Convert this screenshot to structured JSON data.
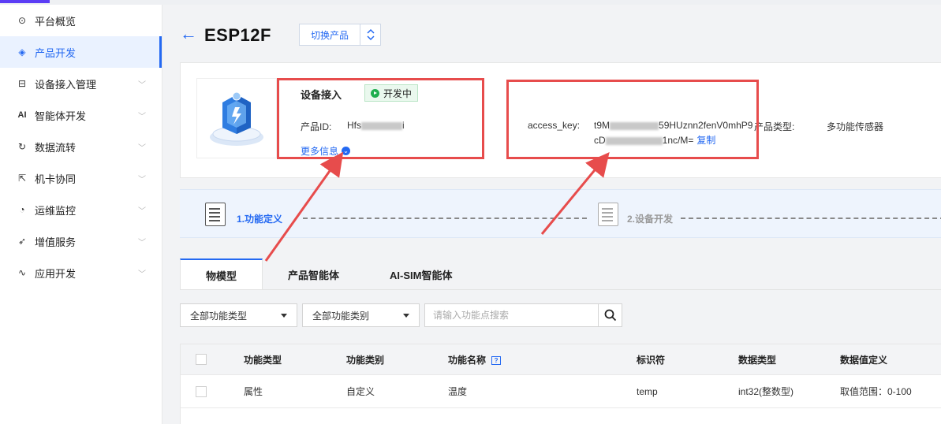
{
  "sidebar": {
    "items": [
      {
        "label": "平台概览",
        "icon": "overview-icon",
        "glyph": "⊙",
        "chevron": false,
        "active": false
      },
      {
        "label": "产品开发",
        "icon": "product-cube-icon",
        "glyph": "◈",
        "chevron": false,
        "active": true
      },
      {
        "label": "设备接入管理",
        "icon": "device-access-icon",
        "glyph": "⊟",
        "chevron": true,
        "active": false
      },
      {
        "label": "智能体开发",
        "icon": "ai-icon",
        "glyph": "AI",
        "chevron": true,
        "active": false
      },
      {
        "label": "数据流转",
        "icon": "data-flow-icon",
        "glyph": "↻",
        "chevron": true,
        "active": false
      },
      {
        "label": "机卡协同",
        "icon": "card-sync-icon",
        "glyph": "⇱",
        "chevron": true,
        "active": false
      },
      {
        "label": "运维监控",
        "icon": "monitor-icon",
        "glyph": "◔",
        "chevron": true,
        "active": false
      },
      {
        "label": "增值服务",
        "icon": "value-added-icon",
        "glyph": "➶",
        "chevron": true,
        "active": false
      },
      {
        "label": "应用开发",
        "icon": "app-dev-icon",
        "glyph": "∿",
        "chevron": true,
        "active": false
      }
    ]
  },
  "header": {
    "back_glyph": "←",
    "title": "ESP12F",
    "switch_label": "切换产品"
  },
  "product": {
    "access_label": "设备接入",
    "status": "开发中",
    "pid_label": "产品ID:",
    "pid_prefix": "Hfs",
    "pid_suffix": "i",
    "more_info": "更多信息",
    "access_key_label": "access_key:",
    "access_key_line1_prefix": "t9M",
    "access_key_line1_suffix": "59HUznn2fenV0mhP9",
    "access_key_line2_prefix": "cD",
    "access_key_line2_suffix": "1nc/M=",
    "copy_label": "复制",
    "type_label": "产品类型:",
    "type_value": "多功能传感器"
  },
  "steps": {
    "step1": "1.功能定义",
    "step2": "2.设备开发"
  },
  "tabs": [
    "物模型",
    "产品智能体",
    "AI-SIM智能体"
  ],
  "filters": {
    "type_select": "全部功能类型",
    "category_select": "全部功能类别",
    "search_placeholder": "请输入功能点搜索"
  },
  "table": {
    "headers": [
      "功能类型",
      "功能类别",
      "功能名称",
      "标识符",
      "数据类型",
      "数据值定义"
    ],
    "rows": [
      [
        "属性",
        "自定义",
        "温度",
        "temp",
        "int32(整数型)",
        "取值范围：0-100"
      ]
    ]
  },
  "colors": {
    "accent": "#2469f2",
    "highlight_box": "#e74c4c",
    "status_green": "#1fae4f"
  }
}
